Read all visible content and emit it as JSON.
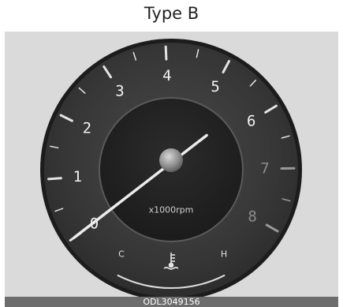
{
  "title": "Type B",
  "caption": "ODL3049156",
  "gauge": {
    "name": "tachometer",
    "unit_label": "x1000rpm",
    "scale_labels": [
      "0",
      "1",
      "2",
      "3",
      "4",
      "5",
      "6",
      "7",
      "8"
    ],
    "redzone_start": 7,
    "needle_value": 0,
    "temp_gauge": {
      "cold_label": "C",
      "hot_label": "H",
      "icon": "coolant-temperature-icon"
    },
    "colors": {
      "background": "#dadada",
      "dial_face": "#3a3a3a",
      "numerals": "#f2f2f2",
      "redzone_numerals": "#8c8c8c",
      "needle": "#e9e9e9"
    }
  }
}
